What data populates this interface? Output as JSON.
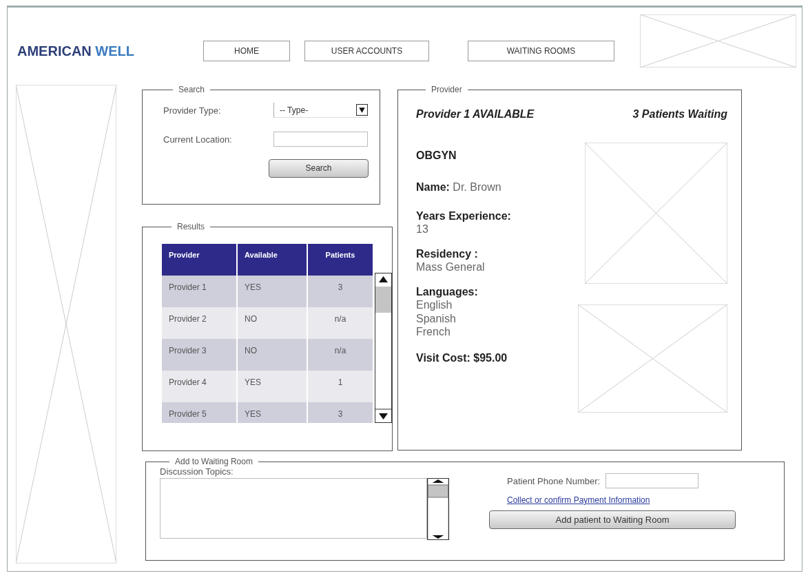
{
  "logo": {
    "text": "AMERICAN",
    "accent": "WELL"
  },
  "nav": [
    {
      "label": "HOME"
    },
    {
      "label": "USER ACCOUNTS"
    },
    {
      "label": "WAITING ROOMS"
    }
  ],
  "search": {
    "title": "Search",
    "provider_type_label": "Provider Type:",
    "provider_type_value": "-- Type-",
    "location_label": "Current Location:",
    "button": "Search"
  },
  "results": {
    "title": "Results",
    "columns": [
      "Provider",
      "Available",
      "Patients"
    ],
    "rows": [
      [
        "Provider 1",
        "YES",
        "3"
      ],
      [
        "Provider 2",
        "NO",
        "n/a"
      ],
      [
        "Provider 3",
        "NO",
        "n/a"
      ],
      [
        "Provider 4",
        "YES",
        "1"
      ],
      [
        "Provider 5",
        "YES",
        "3"
      ]
    ]
  },
  "provider": {
    "title": "Provider",
    "status": "Provider 1 AVAILABLE",
    "waiting": "3 Patients Waiting",
    "specialty": "OBGYN",
    "name_line": "**Name:** Dr. Brown",
    "fields": [
      {
        "label": "Years Experience:",
        "values": [
          "13"
        ]
      },
      {
        "label": "Residency :",
        "values": [
          "Mass General"
        ]
      },
      {
        "label": "Languages:",
        "values": [
          "English",
          "Spanish",
          "French"
        ]
      }
    ],
    "cost": "Visit Cost: $95.00"
  },
  "waiting_room": {
    "title": "Add to Waiting Room",
    "topics_label": "Discussion Topics:",
    "phone_label": "Patient Phone Number:",
    "payment_link": "Collect or confirm Payment Information",
    "button": "Add patient to Waiting Room"
  }
}
